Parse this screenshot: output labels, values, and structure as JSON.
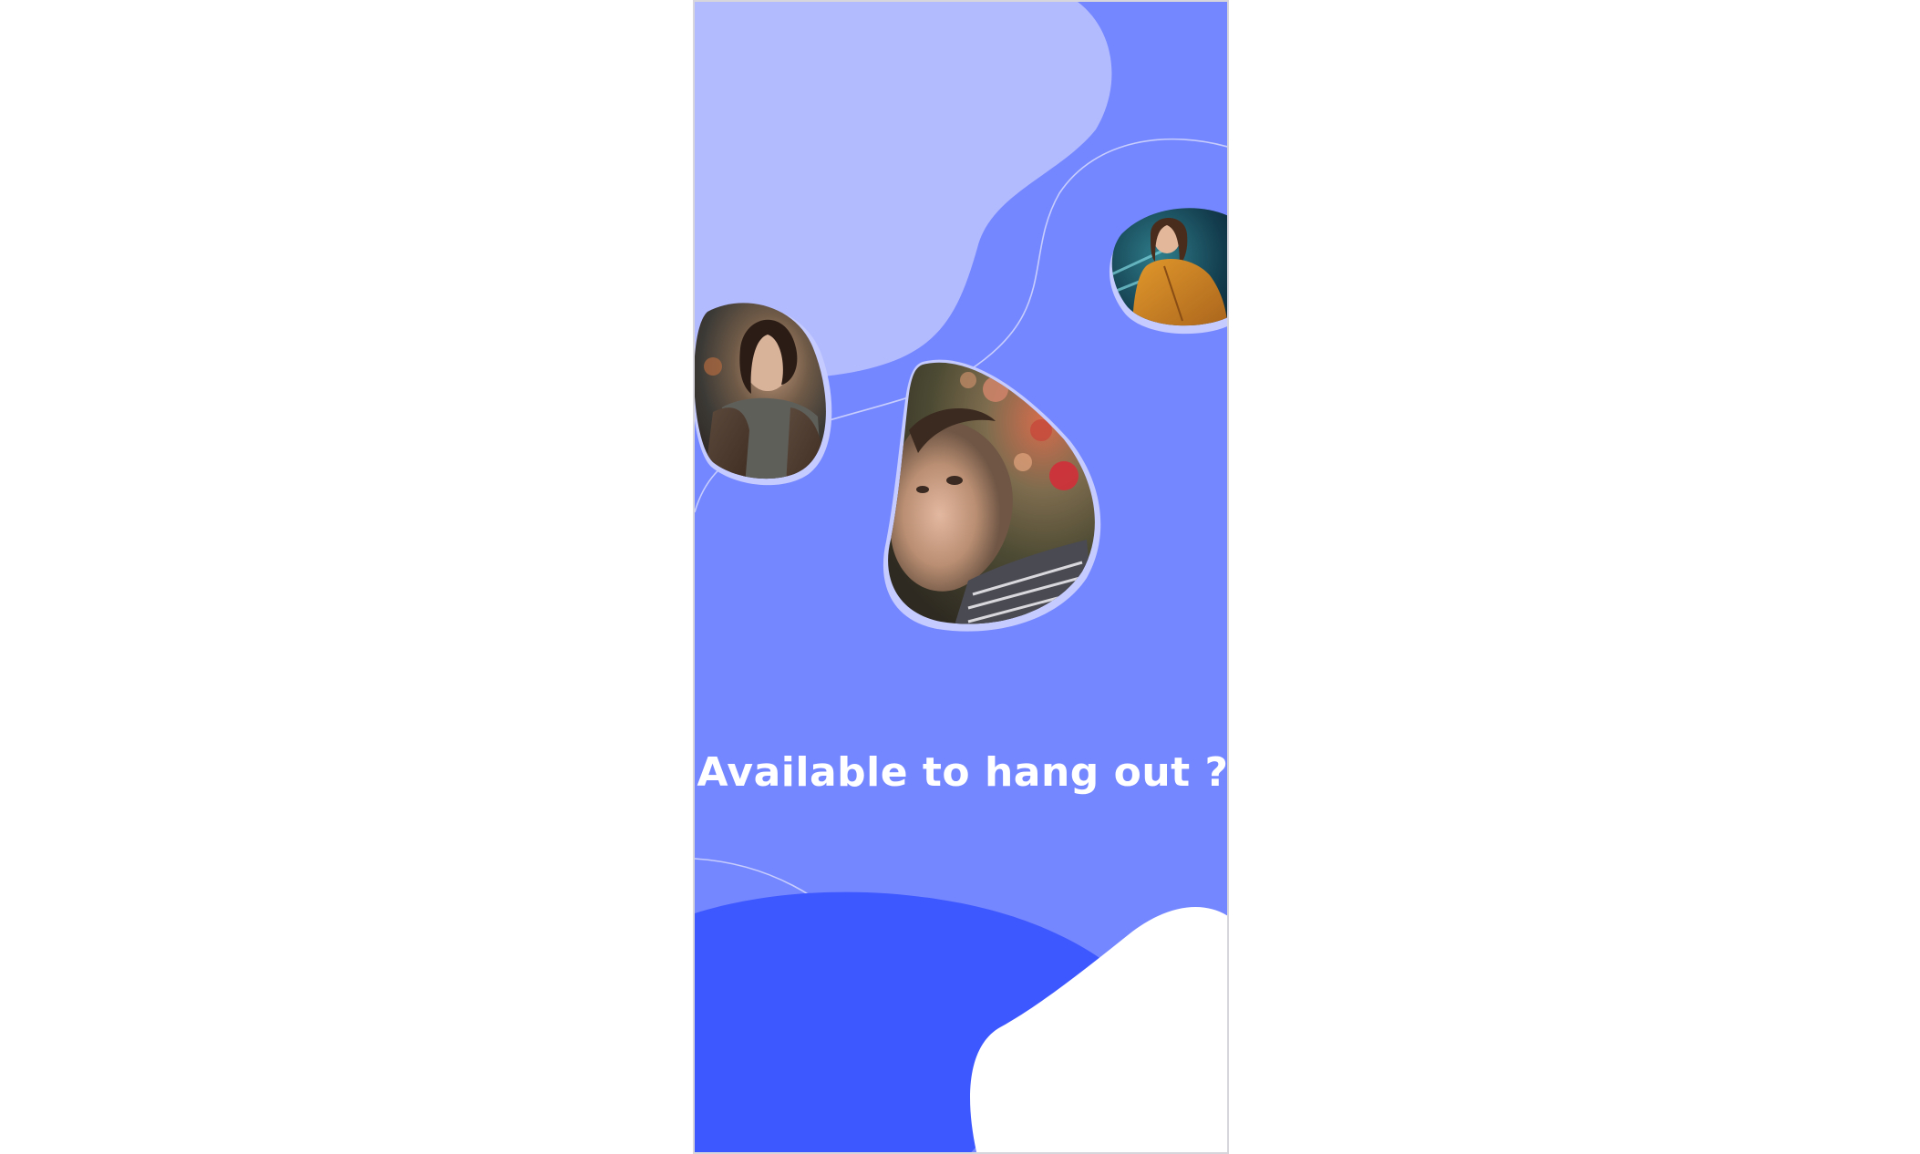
{
  "onboarding": {
    "headline": "Available to hang out ?"
  },
  "colors": {
    "background": "#7587ff",
    "light_blob": "#b3bbff",
    "dark_blob": "#3e58ff",
    "white_blob": "#ffffff",
    "line": "#c7cdfd",
    "photo_ring": "#c5cbff"
  },
  "photos": [
    {
      "name": "woman-in-vest-photo"
    },
    {
      "name": "man-with-flowers-photo"
    },
    {
      "name": "woman-in-orange-jacket-photo"
    }
  ]
}
